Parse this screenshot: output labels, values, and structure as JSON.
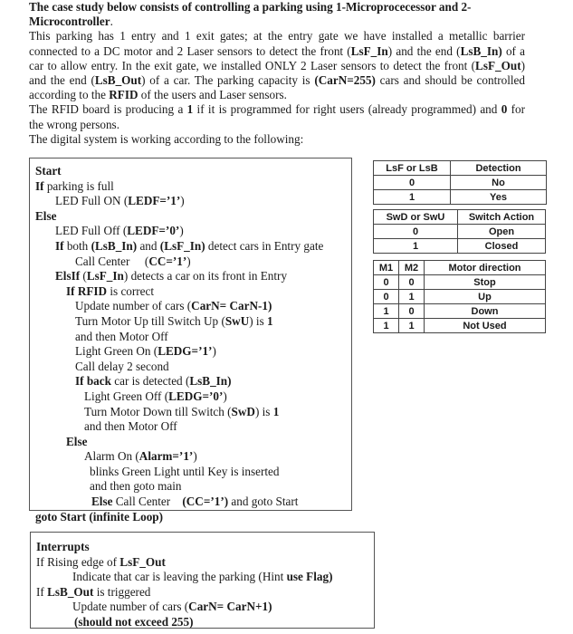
{
  "intro": {
    "title_line": "The case study below consists of controlling a parking using 1-Microprocecessor and 2-Microcontroller",
    "title_end": ".",
    "p1": [
      {
        "t": "This parking has 1 entry and 1 exit gates; at the entry gate we have installed a metallic barrier connected to a DC motor and 2 Laser sensors to detect the front (",
        "b": false
      },
      {
        "t": "LsF_In",
        "b": true
      },
      {
        "t": ") and the end (",
        "b": false
      },
      {
        "t": "LsB_In)",
        "b": true
      },
      {
        "t": " of a car to allow entry. In the exit gate, we installed ONLY 2 Laser sensors to detect the front (",
        "b": false
      },
      {
        "t": "LsF_Out",
        "b": true
      },
      {
        "t": ") and the end (",
        "b": false
      },
      {
        "t": "LsB_Out",
        "b": true
      },
      {
        "t": ") of a car. The parking capacity is ",
        "b": false
      },
      {
        "t": "(CarN=255)",
        "b": true
      },
      {
        "t": " cars and should be controlled according to the ",
        "b": false
      },
      {
        "t": "RFID",
        "b": true
      },
      {
        "t": " of the users and Laser sensors.",
        "b": false
      }
    ],
    "p2": [
      {
        "t": "The RFID board is producing a ",
        "b": false
      },
      {
        "t": "1",
        "b": true
      },
      {
        "t": " if it is programmed for right users (already programmed) and ",
        "b": false
      },
      {
        "t": "0",
        "b": true
      },
      {
        "t": " for the wrong persons.",
        "b": false
      }
    ],
    "p3": "The digital system is working according to the following:"
  },
  "algorithm": [
    {
      "indent": 0,
      "parts": [
        {
          "t": "Start",
          "b": true
        }
      ]
    },
    {
      "indent": 0,
      "parts": [
        {
          "t": "If",
          "b": true
        },
        {
          "t": " parking is full",
          "b": false
        }
      ]
    },
    {
      "indent": 1,
      "parts": [
        {
          "t": "LED Full ON (",
          "b": false
        },
        {
          "t": "LEDF=’1’",
          "b": true
        },
        {
          "t": ")",
          "b": false
        }
      ]
    },
    {
      "indent": 0,
      "parts": [
        {
          "t": "Else",
          "b": true
        }
      ]
    },
    {
      "indent": 1,
      "parts": [
        {
          "t": "LED Full Off (",
          "b": false
        },
        {
          "t": "LEDF=’0’",
          "b": true
        },
        {
          "t": ")",
          "b": false
        }
      ]
    },
    {
      "indent": 1,
      "parts": [
        {
          "t": "If",
          "b": true
        },
        {
          "t": " both ",
          "b": false
        },
        {
          "t": "(LsB_In)",
          "b": true
        },
        {
          "t": " and ",
          "b": false
        },
        {
          "t": "(LsF_In)",
          "b": true
        },
        {
          "t": " detect cars in Entry gate",
          "b": false
        }
      ]
    },
    {
      "indent": 3,
      "parts": [
        {
          "t": "Call Center     (",
          "b": false
        },
        {
          "t": "CC=’1’",
          "b": true
        },
        {
          "t": ")",
          "b": false
        }
      ]
    },
    {
      "indent": 1,
      "parts": [
        {
          "t": "ElsIf",
          "b": true
        },
        {
          "t": " (",
          "b": false
        },
        {
          "t": "LsF_In",
          "b": true
        },
        {
          "t": ") detects a car on its front in Entry",
          "b": false
        }
      ]
    },
    {
      "indent": 2,
      "parts": [
        {
          "t": "If RFID",
          "b": true
        },
        {
          "t": " is correct",
          "b": false
        }
      ]
    },
    {
      "indent": 3,
      "parts": [
        {
          "t": "Update number of cars (",
          "b": false
        },
        {
          "t": "CarN= CarN-1)",
          "b": true
        }
      ]
    },
    {
      "indent": 3,
      "parts": [
        {
          "t": "Turn Motor Up till Switch Up (",
          "b": false
        },
        {
          "t": "SwU",
          "b": true
        },
        {
          "t": ") is ",
          "b": false
        },
        {
          "t": "1",
          "b": true
        }
      ]
    },
    {
      "indent": 3,
      "parts": [
        {
          "t": "and then Motor Off",
          "b": false
        }
      ]
    },
    {
      "indent": 3,
      "parts": [
        {
          "t": "Light Green On (",
          "b": false
        },
        {
          "t": "LEDG=’1’",
          "b": true
        },
        {
          "t": ")",
          "b": false
        }
      ]
    },
    {
      "indent": 3,
      "parts": [
        {
          "t": "Call delay 2 second",
          "b": false
        }
      ]
    },
    {
      "indent": 3,
      "parts": [
        {
          "t": "If back",
          "b": true
        },
        {
          "t": " car is detected (",
          "b": false
        },
        {
          "t": "LsB_In)",
          "b": true
        }
      ]
    },
    {
      "indent": 4,
      "parts": [
        {
          "t": "Light Green Off (",
          "b": false
        },
        {
          "t": "LEDG=’0’",
          "b": true
        },
        {
          "t": ")",
          "b": false
        }
      ]
    },
    {
      "indent": 4,
      "parts": [
        {
          "t": "Turn Motor Down till Switch (",
          "b": false
        },
        {
          "t": "SwD",
          "b": true
        },
        {
          "t": ") is ",
          "b": false
        },
        {
          "t": "1",
          "b": true
        }
      ]
    },
    {
      "indent": 4,
      "parts": [
        {
          "t": "and then Motor Off",
          "b": false
        }
      ]
    },
    {
      "indent": 2,
      "parts": [
        {
          "t": "Else",
          "b": true
        }
      ]
    },
    {
      "indent": 4,
      "parts": [
        {
          "t": "Alarm On (",
          "b": false
        },
        {
          "t": "Alarm=’1’",
          "b": true
        },
        {
          "t": ")",
          "b": false
        }
      ]
    },
    {
      "indent": 5,
      "parts": [
        {
          "t": "blinks Green Light until Key is inserted",
          "b": false
        }
      ]
    },
    {
      "indent": 5,
      "parts": [
        {
          "t": "and then goto main",
          "b": false
        }
      ]
    },
    {
      "indent": 6,
      "parts": [
        {
          "t": "Else",
          "b": true
        },
        {
          "t": " Call Center    ",
          "b": false
        },
        {
          "t": "(CC=’1’)",
          "b": true
        },
        {
          "t": " and goto Start",
          "b": false
        }
      ]
    },
    {
      "indent": 0,
      "parts": [
        {
          "t": "goto Start (infinite Loop)",
          "b": true
        }
      ]
    }
  ],
  "interrupts": [
    {
      "indent": 0,
      "parts": [
        {
          "t": "Interrupts",
          "b": true
        }
      ]
    },
    {
      "indent": 0,
      "parts": [
        {
          "t": "If Rising edge of ",
          "b": false
        },
        {
          "t": "LsF_Out",
          "b": true
        }
      ]
    },
    {
      "indent": 1,
      "parts": [
        {
          "t": "Indicate that car is leaving the parking (Hint ",
          "b": false
        },
        {
          "t": "use Flag)",
          "b": true
        }
      ]
    },
    {
      "indent": 0,
      "parts": [
        {
          "t": "If ",
          "b": false
        },
        {
          "t": "LsB_Out",
          "b": true
        },
        {
          "t": " is triggered",
          "b": false
        }
      ]
    },
    {
      "indent": 1,
      "parts": [
        {
          "t": "Update number of cars (",
          "b": false
        },
        {
          "t": "CarN= CarN+1)",
          "b": true
        }
      ]
    },
    {
      "indent": 2,
      "parts": [
        {
          "t": "(should not exceed 255)",
          "b": true
        }
      ]
    }
  ],
  "tables": {
    "sensor": {
      "headers": [
        "LsF or LsB",
        "Detection"
      ],
      "rows": [
        [
          "0",
          "No"
        ],
        [
          "1",
          "Yes"
        ]
      ]
    },
    "switch": {
      "headers": [
        "SwD or SwU",
        "Switch Action"
      ],
      "rows": [
        [
          "0",
          "Open"
        ],
        [
          "1",
          "Closed"
        ]
      ]
    },
    "motor": {
      "headers": [
        "M1",
        "M2",
        "Motor direction"
      ],
      "rows": [
        [
          "0",
          "0",
          "Stop"
        ],
        [
          "0",
          "1",
          "Up"
        ],
        [
          "1",
          "0",
          "Down"
        ],
        [
          "1",
          "1",
          "Not Used"
        ]
      ]
    }
  }
}
